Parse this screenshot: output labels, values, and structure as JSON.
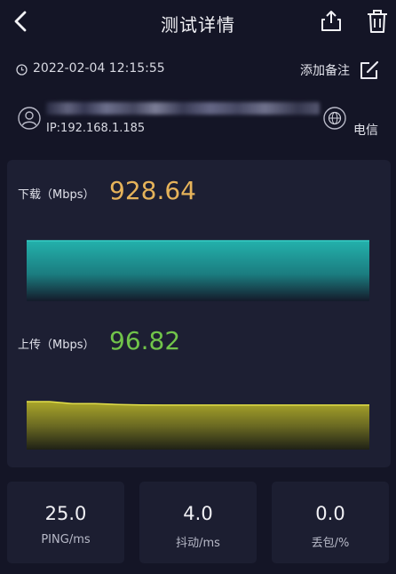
{
  "header": {
    "title": "测试详情",
    "back_icon": "chevron-left-icon",
    "share_icon": "share-upload-icon",
    "delete_icon": "trash-icon"
  },
  "meta": {
    "timestamp": "2022-02-04 12:15:55",
    "add_note_label": "添加备注",
    "edit_icon": "edit-pencil-icon"
  },
  "device": {
    "ip": "IP:192.168.1.185",
    "isp": "电信"
  },
  "download": {
    "label": "下载（Mbps）",
    "value": "928.64",
    "color": "#e6b35a"
  },
  "upload": {
    "label": "上传（Mbps）",
    "value": "96.82",
    "color": "#71c44a"
  },
  "chart_data": [
    {
      "type": "area",
      "series": [
        {
          "values": [
            928.64,
            928.64,
            928.64,
            928.64,
            928.64,
            928.64,
            928.64,
            928.64,
            928.64,
            928.64,
            928.64
          ]
        }
      ],
      "colors": {
        "top": "#23b1ac",
        "bottom": "#141a2a"
      }
    },
    {
      "type": "area",
      "series": [
        {
          "values": [
            97,
            97,
            96.9,
            96.9,
            96.85,
            96.83,
            96.82,
            96.82,
            96.82,
            96.82,
            96.82,
            96.82,
            96.82,
            96.82,
            96.82,
            96.82
          ]
        }
      ],
      "colors": {
        "line": "#e3e04a",
        "top": "#aaa62a",
        "bottom": "#1f2116"
      }
    }
  ],
  "stats": [
    {
      "value": "25.0",
      "label": "PING/ms"
    },
    {
      "value": "4.0",
      "label": "抖动/ms"
    },
    {
      "value": "0.0",
      "label": "丢包/%"
    }
  ]
}
